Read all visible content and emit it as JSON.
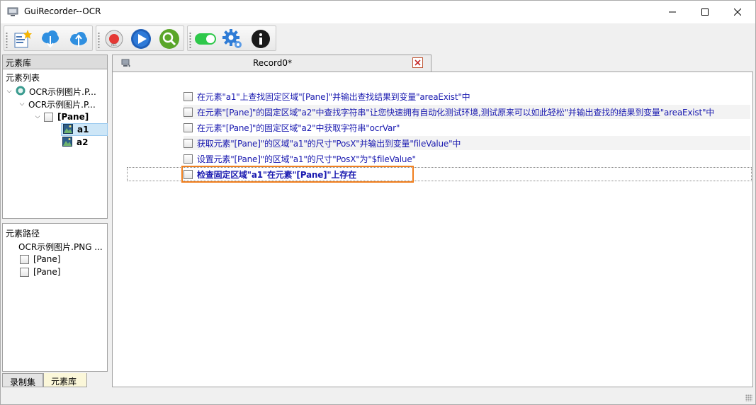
{
  "window": {
    "title": "GuiRecorder--OCR"
  },
  "toolbar": {
    "buttons": [
      "new-record-icon",
      "download-icon",
      "upload-icon",
      "record-icon",
      "play-icon",
      "search-icon",
      "toggle-icon",
      "settings-icon",
      "info-icon"
    ]
  },
  "left_panel": {
    "header": "元素库",
    "list_title": "元素列表",
    "tree": [
      {
        "label": "OCR示例图片.P..."
      },
      {
        "label": "OCR示例图片.P..."
      },
      {
        "label": "[Pane]"
      },
      {
        "label": "a1"
      },
      {
        "label": "a2"
      }
    ]
  },
  "path_panel": {
    "title": "元素路径",
    "items": [
      "OCR示例图片.PNG ...",
      "[Pane]",
      "[Pane]"
    ]
  },
  "bottom_tabs": [
    "录制集",
    "元素库"
  ],
  "document": {
    "tab_title": "Record0*",
    "steps": [
      "在元素\"a1\"上查找固定区域\"[Pane]\"并输出查找结果到变量\"areaExist\"中",
      "在元素\"[Pane]\"的固定区域\"a2\"中查找字符串\"让您快速拥有自动化测试环境,测试原来可以如此轻松\"并输出查找的结果到变量\"areaExist\"中",
      "在元素\"[Pane]\"的固定区域\"a2\"中获取字符串\"ocrVar\"",
      "获取元素\"[Pane]\"的区域\"a1\"的尺寸\"PosX\"并输出到变量\"fileValue\"中",
      "设置元素\"[Pane]\"的区域\"a1\"的尺寸\"PosX\"为\"$fileValue\"",
      "检查固定区域\"a1\"在元素\"[Pane]\"上存在"
    ]
  },
  "colors": {
    "step_text": "#1a1ab0",
    "highlight": "#f07f1e",
    "selection": "#cde6f7"
  }
}
